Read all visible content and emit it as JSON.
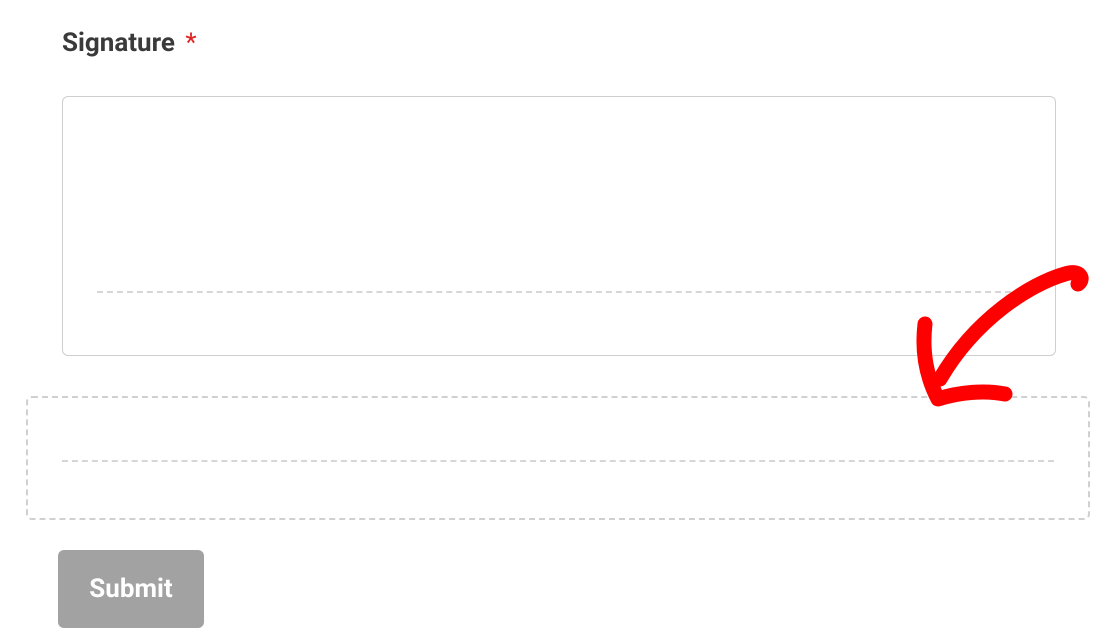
{
  "form": {
    "signature_label": "Signature",
    "required_marker": "*",
    "submit_label": "Submit"
  }
}
